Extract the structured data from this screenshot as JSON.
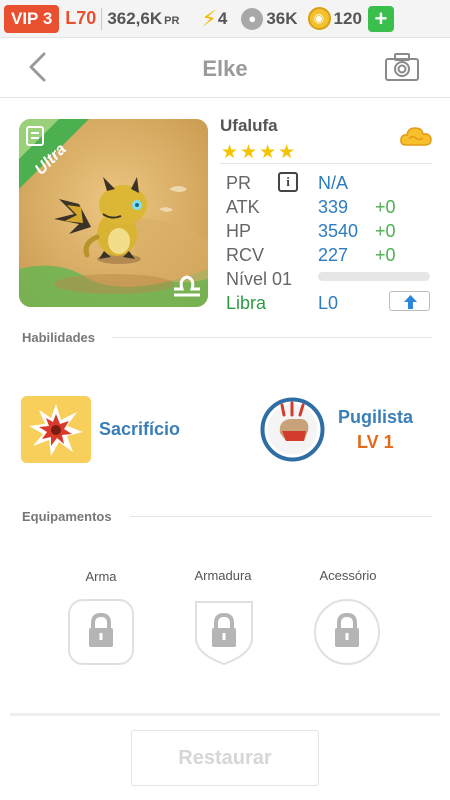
{
  "status": {
    "vip": "VIP 3",
    "level": "L70",
    "pr_value": "362,6K",
    "pr_unit": "PR",
    "energy": "4",
    "paws": "36K",
    "coins": "120",
    "add": "+"
  },
  "header": {
    "title": "Elke"
  },
  "pet": {
    "rarity": "Ultra",
    "name": "Ufalufa",
    "stars": "★★★★",
    "stats": [
      {
        "label": "PR",
        "value": "N/A"
      },
      {
        "label": "ATK",
        "value": "339",
        "bonus": "+0"
      },
      {
        "label": "HP",
        "value": "3540",
        "bonus": "+0"
      },
      {
        "label": "RCV",
        "value": "227",
        "bonus": "+0"
      }
    ],
    "level_label": "Nível 01",
    "xp_fraction": 0,
    "sign": "Libra",
    "sign_level": "L0"
  },
  "skills": {
    "title": "Habilidades",
    "active": "Sacrifício",
    "passive": "Pugilista",
    "passive_level": "LV 1"
  },
  "equipment": {
    "title": "Equipamentos",
    "slots": [
      "Arma",
      "Armadura",
      "Acessório"
    ]
  },
  "actions": {
    "restore": "Restaurar"
  },
  "colors": {
    "accent_orange": "#e8502f",
    "ultra_green": "#4caf50",
    "stat_blue": "#2e7cc0",
    "bonus_green": "#4caf50",
    "skill_blue": "#3a7fb8",
    "level_orange": "#e36a1b"
  },
  "icons": {
    "energy": "lightning-bolt-icon",
    "paws": "paw-icon",
    "coins": "coin-icon",
    "back": "chevron-left-icon",
    "camera": "camera-icon",
    "element": "cloud-icon",
    "sign": "libra-icon",
    "lock": "lock-icon"
  }
}
